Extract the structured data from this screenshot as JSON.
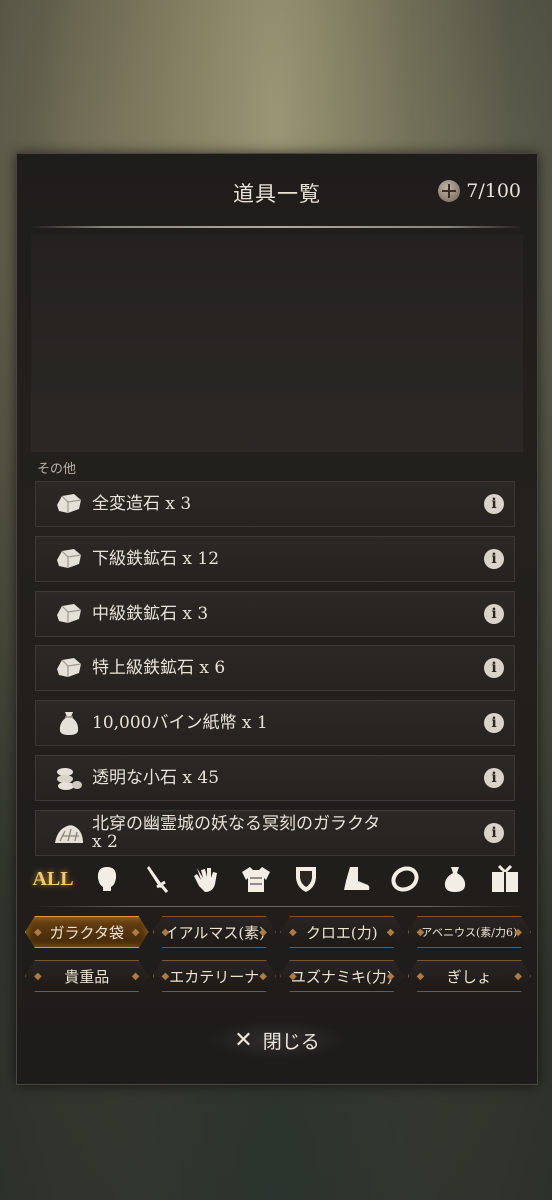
{
  "header": {
    "title": "道具一覧",
    "capacity": "7/100"
  },
  "section": {
    "label": "その他"
  },
  "items": [
    {
      "label": "全変造石 x 3",
      "icon": "ore-stone-icon"
    },
    {
      "label": "下級鉄鉱石 x 12",
      "icon": "ore-stone-icon"
    },
    {
      "label": "中級鉄鉱石 x 3",
      "icon": "ore-stone-icon"
    },
    {
      "label": "特上級鉄鉱石 x 6",
      "icon": "ore-stone-icon"
    },
    {
      "label": "10,000バイン紙幣 x 1",
      "icon": "money-bag-icon"
    },
    {
      "label": "透明な小石 x 45",
      "icon": "pebbles-icon"
    },
    {
      "label_line1": "北穿の幽霊城の妖なる冥刻のガラクタ",
      "label_line2": "x 2",
      "icon": "junk-pile-icon"
    }
  ],
  "info_glyph": "i",
  "categories": {
    "all_label": "ALL",
    "icons": [
      "head-icon",
      "sword-icon",
      "glove-icon",
      "armor-icon",
      "shield-icon",
      "boot-icon",
      "ring-icon",
      "pouch-icon",
      "gift-box-icon"
    ]
  },
  "filters": [
    {
      "label": "ガラクタ袋",
      "active": true
    },
    {
      "label": "イアルマス(素)",
      "active": false
    },
    {
      "label": "クロエ(力)",
      "active": false
    },
    {
      "label": "アベニウス(素/力6)",
      "active": false
    },
    {
      "label": "貴重品",
      "active": false
    },
    {
      "label": "エカテリーナ",
      "active": false
    },
    {
      "label": "ユズナミキ(力)",
      "active": false
    },
    {
      "label": "ぎしょ",
      "active": false
    }
  ],
  "close": {
    "glyph": "✕",
    "label": "閉じる"
  },
  "colors": {
    "accent": "#f0c77a",
    "panel": "#1f1d1b",
    "text": "#e8e2d8"
  }
}
